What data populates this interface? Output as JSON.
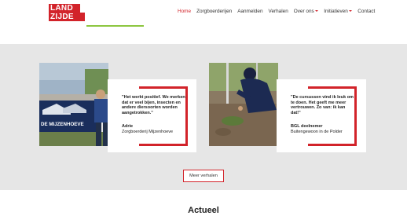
{
  "header": {
    "logo_line1": "LAND",
    "logo_line2": "ZIJDE",
    "nav": [
      {
        "label": "Home",
        "active": true,
        "dropdown": false
      },
      {
        "label": "Zorgboerderijen",
        "active": false,
        "dropdown": false
      },
      {
        "label": "Aanmelden",
        "active": false,
        "dropdown": false
      },
      {
        "label": "Verhalen",
        "active": false,
        "dropdown": false
      },
      {
        "label": "Over ons",
        "active": false,
        "dropdown": true
      },
      {
        "label": "Initiatieven",
        "active": false,
        "dropdown": true
      },
      {
        "label": "Contact",
        "active": false,
        "dropdown": false
      }
    ]
  },
  "testimonials": [
    {
      "quote": "\"Het werkt positief. We merken dat er veel bijen, insecten en andere diersoorten worden aangetrokken.\"",
      "author": "Adrie",
      "org": "Zorgboerderij Mijzenhoeve",
      "photo_banner": "DE MIJZENHOEVE"
    },
    {
      "quote": "\"De cursussen vind ik leuk om te doen. Het geeft me meer vertrouwen. Zo van: ik kan dat!\"",
      "author": "BGL deelnemer",
      "org": "Buitengewoon in de Polder"
    }
  ],
  "more_button": "Meer verhalen",
  "section_title": "Actueel",
  "colors": {
    "accent": "#d2232a",
    "green": "#8cc63f",
    "band": "#e6e6e6"
  }
}
